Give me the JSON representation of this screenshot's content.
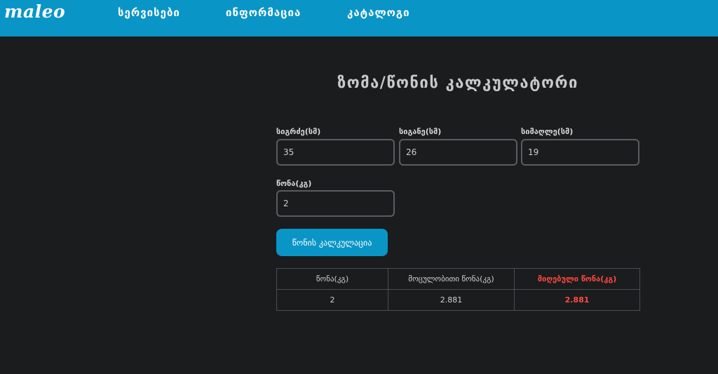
{
  "header": {
    "logo": "maleo",
    "nav": [
      "სერვისები",
      "ინფორმაცია",
      "კატალოგი"
    ]
  },
  "calculator": {
    "title": "ზომა/წონის კალკულატორი",
    "fields": {
      "length": {
        "label": "სიგრძე(სმ)",
        "value": "35"
      },
      "width": {
        "label": "სიგანე(სმ)",
        "value": "26"
      },
      "height": {
        "label": "სიმაღლე(სმ)",
        "value": "19"
      },
      "weight": {
        "label": "წონა(კგ)",
        "value": "2"
      }
    },
    "button_label": "წონის კალკულაცია"
  },
  "results": {
    "headers": [
      "წონა(კგ)",
      "მოცულობითი წონა(კგ)",
      "მიღებული წონა(კგ)"
    ],
    "row": [
      "2",
      "2.881",
      "2.881"
    ]
  },
  "colors": {
    "header_bg": "#0a95c7",
    "page_bg": "#1b1c1e",
    "button_bg": "#0a95c7",
    "highlight": "#ff4a3d"
  }
}
